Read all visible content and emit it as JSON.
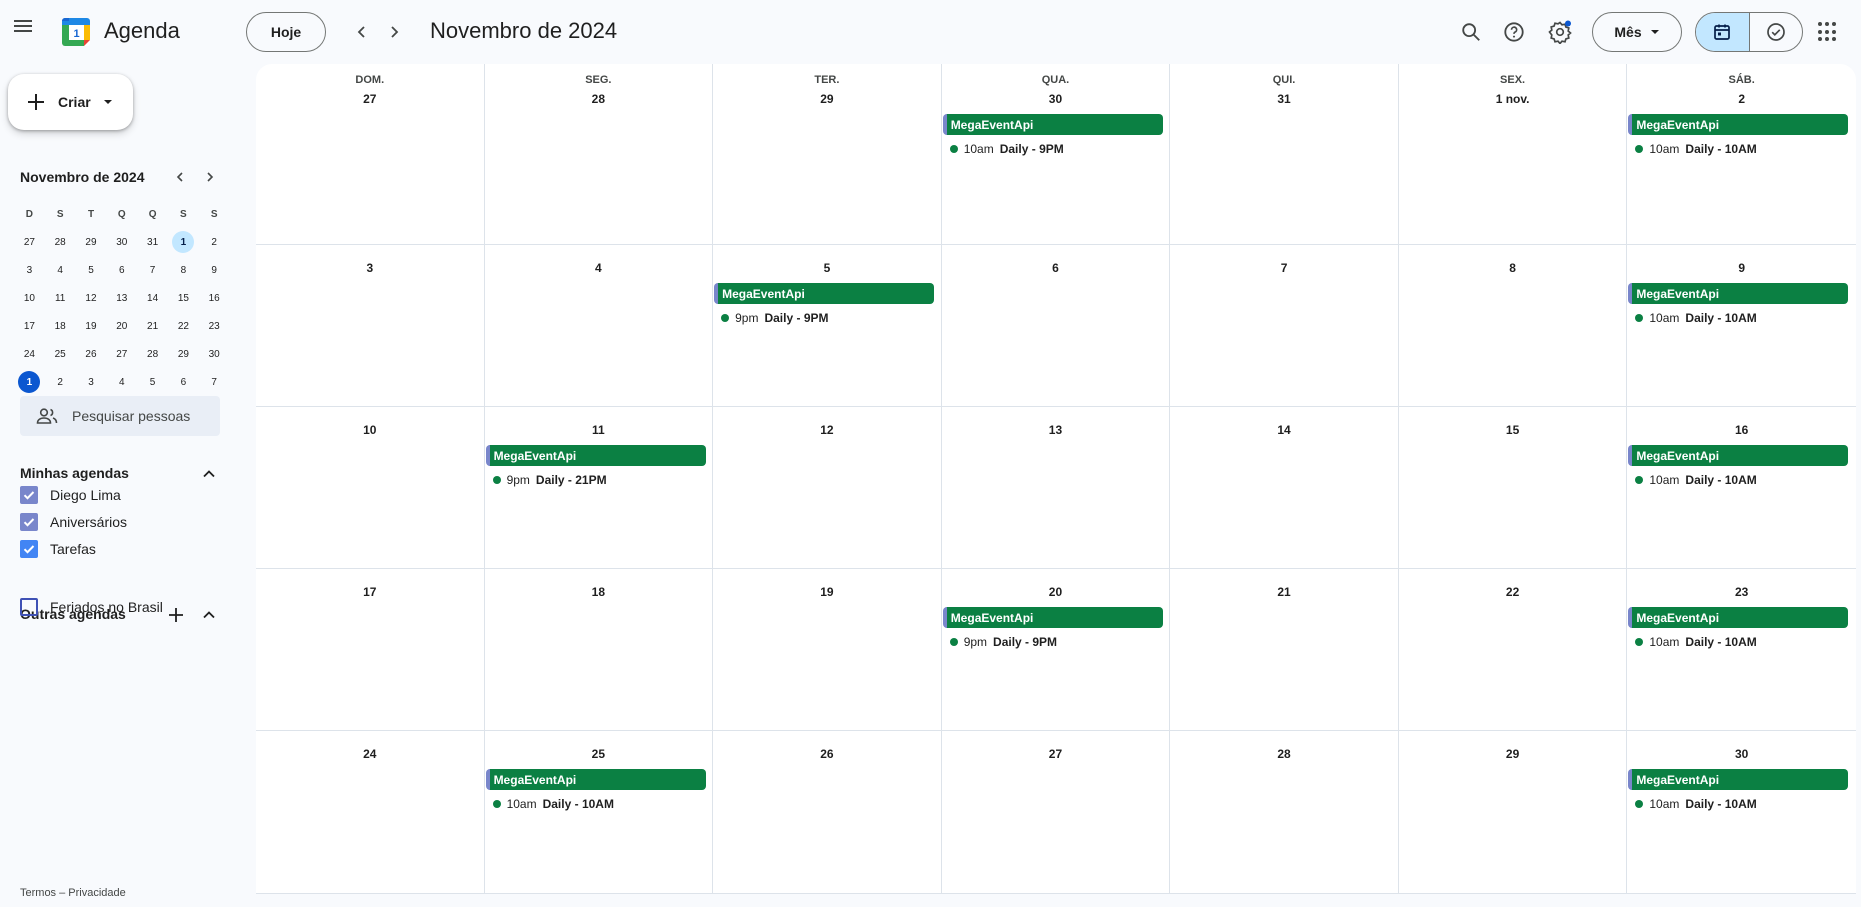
{
  "header": {
    "app_title": "Agenda",
    "today_label": "Hoje",
    "period_title": "Novembro de 2024",
    "view_label": "Mês",
    "logo_day": "1"
  },
  "sidebar": {
    "create_label": "Criar",
    "mini_month_title": "Novembro de 2024",
    "weekday_heads": [
      "D",
      "S",
      "T",
      "Q",
      "Q",
      "S",
      "S"
    ],
    "mini_weeks": [
      [
        "27",
        "28",
        "29",
        "30",
        "31",
        "1",
        "2"
      ],
      [
        "3",
        "4",
        "5",
        "6",
        "7",
        "8",
        "9"
      ],
      [
        "10",
        "11",
        "12",
        "13",
        "14",
        "15",
        "16"
      ],
      [
        "17",
        "18",
        "19",
        "20",
        "21",
        "22",
        "23"
      ],
      [
        "24",
        "25",
        "26",
        "27",
        "28",
        "29",
        "30"
      ],
      [
        "1",
        "2",
        "3",
        "4",
        "5",
        "6",
        "7"
      ]
    ],
    "search_people_placeholder": "Pesquisar pessoas",
    "my_calendars_title": "Minhas agendas",
    "my_calendars": [
      {
        "label": "Diego Lima",
        "checked": true,
        "color": "#7986cb"
      },
      {
        "label": "Aniversários",
        "checked": true,
        "color": "#7986cb"
      },
      {
        "label": "Tarefas",
        "checked": true,
        "color": "#4285f4"
      }
    ],
    "other_calendars_title": "Outras agendas",
    "other_calendars": [
      {
        "label": "Feriados no Brasil",
        "checked": false,
        "color": "#3f51b5"
      }
    ],
    "footer_terms": "Termos",
    "footer_sep": " – ",
    "footer_privacy": "Privacidade"
  },
  "month": {
    "weekday_labels": [
      "DOM.",
      "SEG.",
      "TER.",
      "QUA.",
      "QUI.",
      "SEX.",
      "SÁB."
    ],
    "weeks": [
      [
        "27",
        "28",
        "29",
        "30",
        "31",
        "1 nov.",
        "2"
      ],
      [
        "3",
        "4",
        "5",
        "6",
        "7",
        "8",
        "9"
      ],
      [
        "10",
        "11",
        "12",
        "13",
        "14",
        "15",
        "16"
      ],
      [
        "17",
        "18",
        "19",
        "20",
        "21",
        "22",
        "23"
      ],
      [
        "24",
        "25",
        "26",
        "27",
        "28",
        "29",
        "30"
      ]
    ],
    "events": [
      {
        "week": 0,
        "day": 3,
        "chip": "MegaEventApi",
        "time": "10am",
        "title": "Daily - 9PM"
      },
      {
        "week": 0,
        "day": 6,
        "chip": "MegaEventApi",
        "time": "10am",
        "title": "Daily - 10AM"
      },
      {
        "week": 1,
        "day": 2,
        "chip": "MegaEventApi",
        "time": "9pm",
        "title": "Daily - 9PM"
      },
      {
        "week": 1,
        "day": 6,
        "chip": "MegaEventApi",
        "time": "10am",
        "title": "Daily - 10AM"
      },
      {
        "week": 2,
        "day": 1,
        "chip": "MegaEventApi",
        "time": "9pm",
        "title": "Daily - 21PM"
      },
      {
        "week": 2,
        "day": 6,
        "chip": "MegaEventApi",
        "time": "10am",
        "title": "Daily - 10AM"
      },
      {
        "week": 3,
        "day": 3,
        "chip": "MegaEventApi",
        "time": "9pm",
        "title": "Daily - 9PM"
      },
      {
        "week": 3,
        "day": 6,
        "chip": "MegaEventApi",
        "time": "10am",
        "title": "Daily - 10AM"
      },
      {
        "week": 4,
        "day": 1,
        "chip": "MegaEventApi",
        "time": "10am",
        "title": "Daily - 10AM"
      },
      {
        "week": 4,
        "day": 6,
        "chip": "MegaEventApi",
        "time": "10am",
        "title": "Daily - 10AM"
      }
    ],
    "event_color": "#0b8043"
  },
  "colors": {
    "accent": "#0b57d0",
    "selected": "#c2e7ff",
    "event": "#0b8043"
  }
}
